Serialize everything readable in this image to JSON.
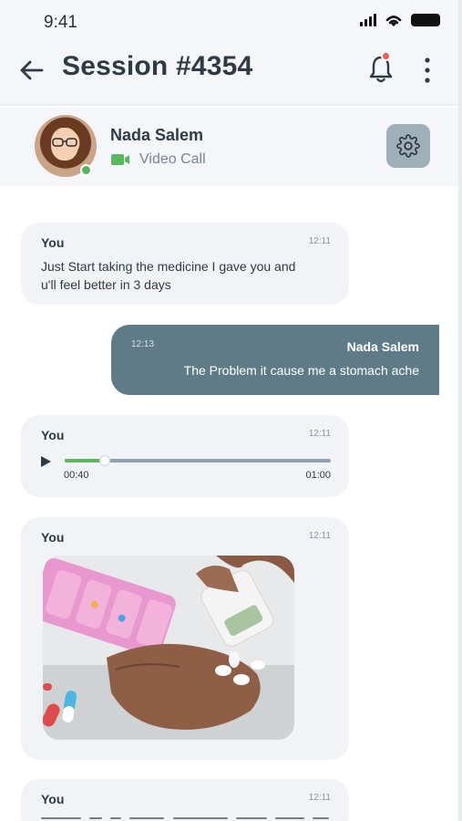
{
  "status_bar": {
    "time": "9:41"
  },
  "header": {
    "title": "Session #4354"
  },
  "profile": {
    "name": "Nada Salem",
    "call_type": "Video Call"
  },
  "messages": [
    {
      "sender": "You",
      "time": "12:11",
      "text_line1": "Just Start taking the medicine I gave you and",
      "text_line2": "u'll feel better in 3 days"
    },
    {
      "sender": "Nada Salem",
      "time": "12:13",
      "text": "The Problem it cause me a stomach ache"
    },
    {
      "sender": "You",
      "time": "12:11",
      "audio_current": "00:40",
      "audio_duration": "01:00",
      "audio_progress": 0.15
    },
    {
      "sender": "You",
      "time": "12:11"
    },
    {
      "sender": "You",
      "time": "12:11"
    }
  ],
  "colors": {
    "accent": "#5f7b88",
    "bell_badge": "#f25b5b",
    "online": "#55b55e",
    "video_icon": "#5cb85c"
  },
  "icons": [
    "back-arrow-icon",
    "bell-icon",
    "more-vertical-icon",
    "video-camera-icon",
    "settings-gear-icon",
    "play-icon"
  ]
}
